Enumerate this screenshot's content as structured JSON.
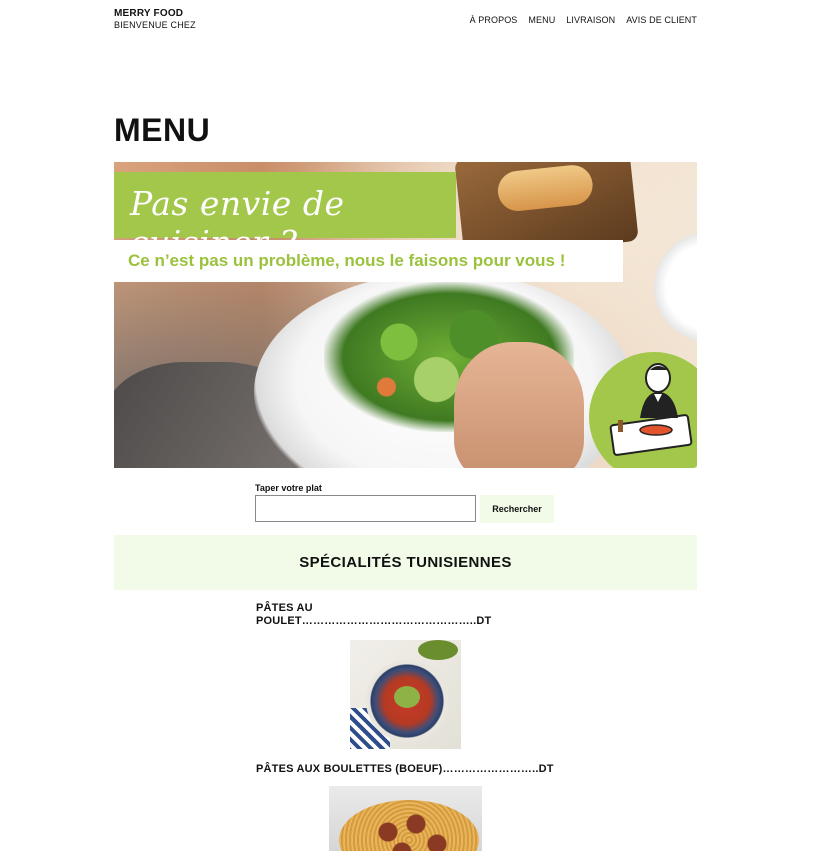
{
  "brand": {
    "name": "MERRY FOOD",
    "tagline": "BIENVENUE CHEZ"
  },
  "nav": [
    {
      "label": "À PROPOS"
    },
    {
      "label": "MENU"
    },
    {
      "label": "LIVRAISON"
    },
    {
      "label": "AVIS DE CLIENT"
    }
  ],
  "page": {
    "title": "MENU"
  },
  "hero": {
    "headline": "Pas envie de cuisiner ?",
    "subline": "Ce n’est pas un problème, nous le faisons pour vous !",
    "accent_color": "#a2c74a",
    "mascot_icon": "chef-mascot-icon"
  },
  "search": {
    "label": "Taper votre plat",
    "value": "",
    "placeholder": "",
    "button_label": "Rechercher"
  },
  "section": {
    "title": "SPÉCIALITÉS TUNISIENNES",
    "band_color": "#f1fbe8"
  },
  "dishes": [
    {
      "title": "PÂTES AU POULET………………………………………..DT"
    },
    {
      "title": "PÂTES AUX BOULETTES (BOEUF)……………………..DT"
    }
  ]
}
